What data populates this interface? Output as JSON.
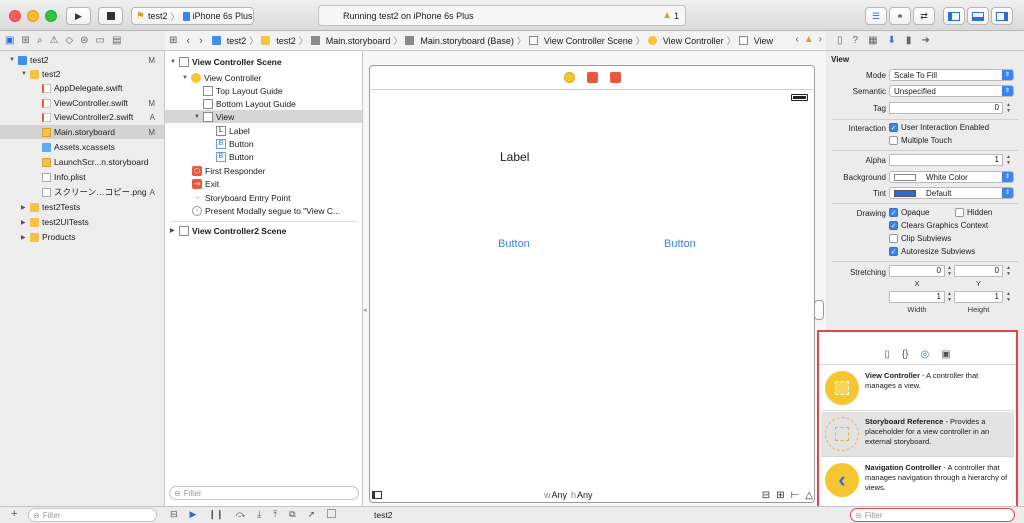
{
  "toolbar": {
    "scheme_target": "test2",
    "scheme_device": "iPhone 6s Plus",
    "status_text": "Running test2 on iPhone 6s Plus",
    "warning_count": "1"
  },
  "jumpbar": {
    "crumbs": [
      "test2",
      "test2",
      "Main.storyboard",
      "Main.storyboard (Base)",
      "View Controller Scene",
      "View Controller",
      "View"
    ]
  },
  "navigator": {
    "items": [
      {
        "label": "test2",
        "status": "M",
        "icon": "project-icon"
      },
      {
        "label": "test2",
        "status": "",
        "icon": "folder-icon"
      },
      {
        "label": "AppDelegate.swift",
        "status": "",
        "icon": "swift-file-icon"
      },
      {
        "label": "ViewController.swift",
        "status": "M",
        "icon": "swift-file-icon"
      },
      {
        "label": "ViewController2.swift",
        "status": "A",
        "icon": "swift-file-icon"
      },
      {
        "label": "Main.storyboard",
        "status": "M",
        "icon": "storyboard-file-icon"
      },
      {
        "label": "Assets.xcassets",
        "status": "",
        "icon": "assets-icon"
      },
      {
        "label": "LaunchScr...n.storyboard",
        "status": "",
        "icon": "storyboard-file-icon"
      },
      {
        "label": "Info.plist",
        "status": "",
        "icon": "plist-icon"
      },
      {
        "label": "スクリーン…コピー.png",
        "status": "A",
        "icon": "image-file-icon"
      },
      {
        "label": "test2Tests",
        "status": "",
        "icon": "folder-icon"
      },
      {
        "label": "test2UITests",
        "status": "",
        "icon": "folder-icon"
      },
      {
        "label": "Products",
        "status": "",
        "icon": "folder-icon"
      }
    ],
    "filter_placeholder": "Filter"
  },
  "outline": {
    "scene1": "View Controller Scene",
    "items": [
      "View Controller",
      "Top Layout Guide",
      "Bottom Layout Guide",
      "View",
      "Label",
      "Button",
      "Button",
      "First Responder",
      "Exit",
      "Storyboard Entry Point",
      "Present Modally segue to \"View C..."
    ],
    "scene2": "View Controller2 Scene",
    "filter_placeholder": "Filter"
  },
  "canvas": {
    "label_text": "Label",
    "button1": "Button",
    "button2": "Button",
    "size_class_w": "w",
    "size_class_w_value": "Any",
    "size_class_h": "h",
    "size_class_h_value": "Any"
  },
  "inspector": {
    "section_title": "View",
    "mode_label": "Mode",
    "mode_value": "Scale To Fill",
    "semantic_label": "Semantic",
    "semantic_value": "Unspecified",
    "tag_label": "Tag",
    "tag_value": "0",
    "interaction_label": "Interaction",
    "user_interaction": "User Interaction Enabled",
    "multiple_touch": "Multiple Touch",
    "alpha_label": "Alpha",
    "alpha_value": "1",
    "background_label": "Background",
    "background_value": "White Color",
    "tint_label": "Tint",
    "tint_value": "Default",
    "drawing_label": "Drawing",
    "opaque": "Opaque",
    "hidden": "Hidden",
    "clears_graphics": "Clears Graphics Context",
    "clip_subviews": "Clip Subviews",
    "autoresize": "Autoresize Subviews",
    "stretching_label": "Stretching",
    "stretch_x": "0",
    "stretch_y": "0",
    "stretch_w": "1",
    "stretch_h": "1",
    "x_label": "X",
    "y_label": "Y",
    "width_label": "Width",
    "height_label": "Height"
  },
  "library": {
    "items": [
      {
        "title": "View Controller",
        "desc": " - A controller that manages a view."
      },
      {
        "title": "Storyboard Reference",
        "desc": " - Provides a placeholder for a view controller in an external storyboard."
      },
      {
        "title": "Navigation Controller",
        "desc": " - A controller that manages navigation through a hierarchy of views."
      }
    ],
    "filter_placeholder": "Filter"
  },
  "bottombar": {
    "debug_target": "test2"
  },
  "colors": {
    "accent": "#3b83f0",
    "highlight_border": "#e7414a",
    "library_yellow": "#f5c631"
  }
}
